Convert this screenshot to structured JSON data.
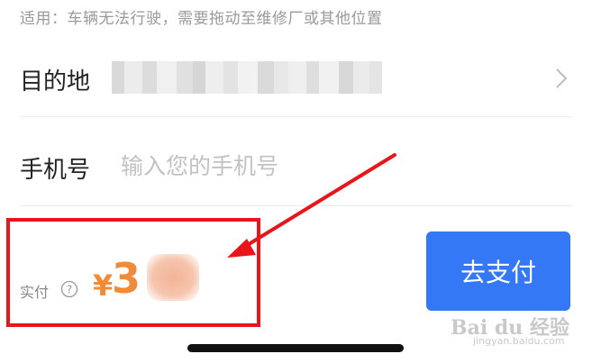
{
  "hint": "适用：车辆无法行驶，需要拖动至维修厂或其他位置",
  "destination": {
    "label": "目的地",
    "icon": "chevron-right-icon"
  },
  "phone": {
    "label": "手机号",
    "placeholder": "输入您的手机号",
    "value": ""
  },
  "payment": {
    "label": "实付",
    "help_icon": "question-circle-icon",
    "currency": "¥",
    "amount_visible": "3",
    "amount_color": "#f08b3a"
  },
  "pay_button": {
    "label": "去支付",
    "color": "#3478f6"
  },
  "annotation": {
    "color": "#e8161b"
  },
  "watermark": {
    "text": "Bai du 经验",
    "sub": "jingyan.baidu.com"
  }
}
